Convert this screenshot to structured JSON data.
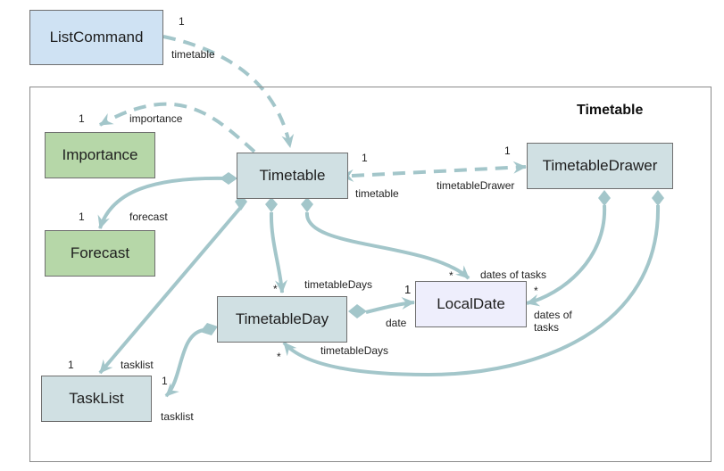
{
  "diagram": {
    "type": "UML class diagram",
    "package": {
      "title": "Timetable"
    },
    "colors": {
      "edge": "#a3c6ca",
      "class_default": "#d0e0e3",
      "class_external": "#cfe2f3",
      "class_enum": "#b6d7a8",
      "class_localdate": "#eeeefc",
      "border": "#6f6f6f"
    },
    "classes": {
      "listcommand": "ListCommand",
      "importance": "Importance",
      "forecast": "Forecast",
      "timetable": "Timetable",
      "timetabledrawer": "TimetableDrawer",
      "timetableday": "TimetableDay",
      "localdate": "LocalDate",
      "tasklist": "TaskList"
    },
    "labels": {
      "lc_mult": "1",
      "lc_role": "timetable",
      "imp_mult": "1",
      "imp_role": "importance",
      "fc_mult": "1",
      "fc_role": "forecast",
      "tt_drawer_mult_left": "1",
      "tt_drawer_role_left": "timetable",
      "tt_drawer_mult_right": "1",
      "tt_drawer_role_right": "timetableDrawer",
      "ttdays_mult": "*",
      "ttdays_role": "timetableDays",
      "ld_mult_top": "*",
      "ld_role_top": "dates of tasks",
      "ld_mult_right": "*",
      "ld_role_right": "dates of\ntasks",
      "date_mult": "1",
      "date_role": "date",
      "ttdays2_mult": "*",
      "ttdays2_role": "timetableDays",
      "tl_mult_top": "1",
      "tl_role_top": "tasklist",
      "tl_mult_right": "1",
      "tl_role_right": "tasklist"
    }
  }
}
